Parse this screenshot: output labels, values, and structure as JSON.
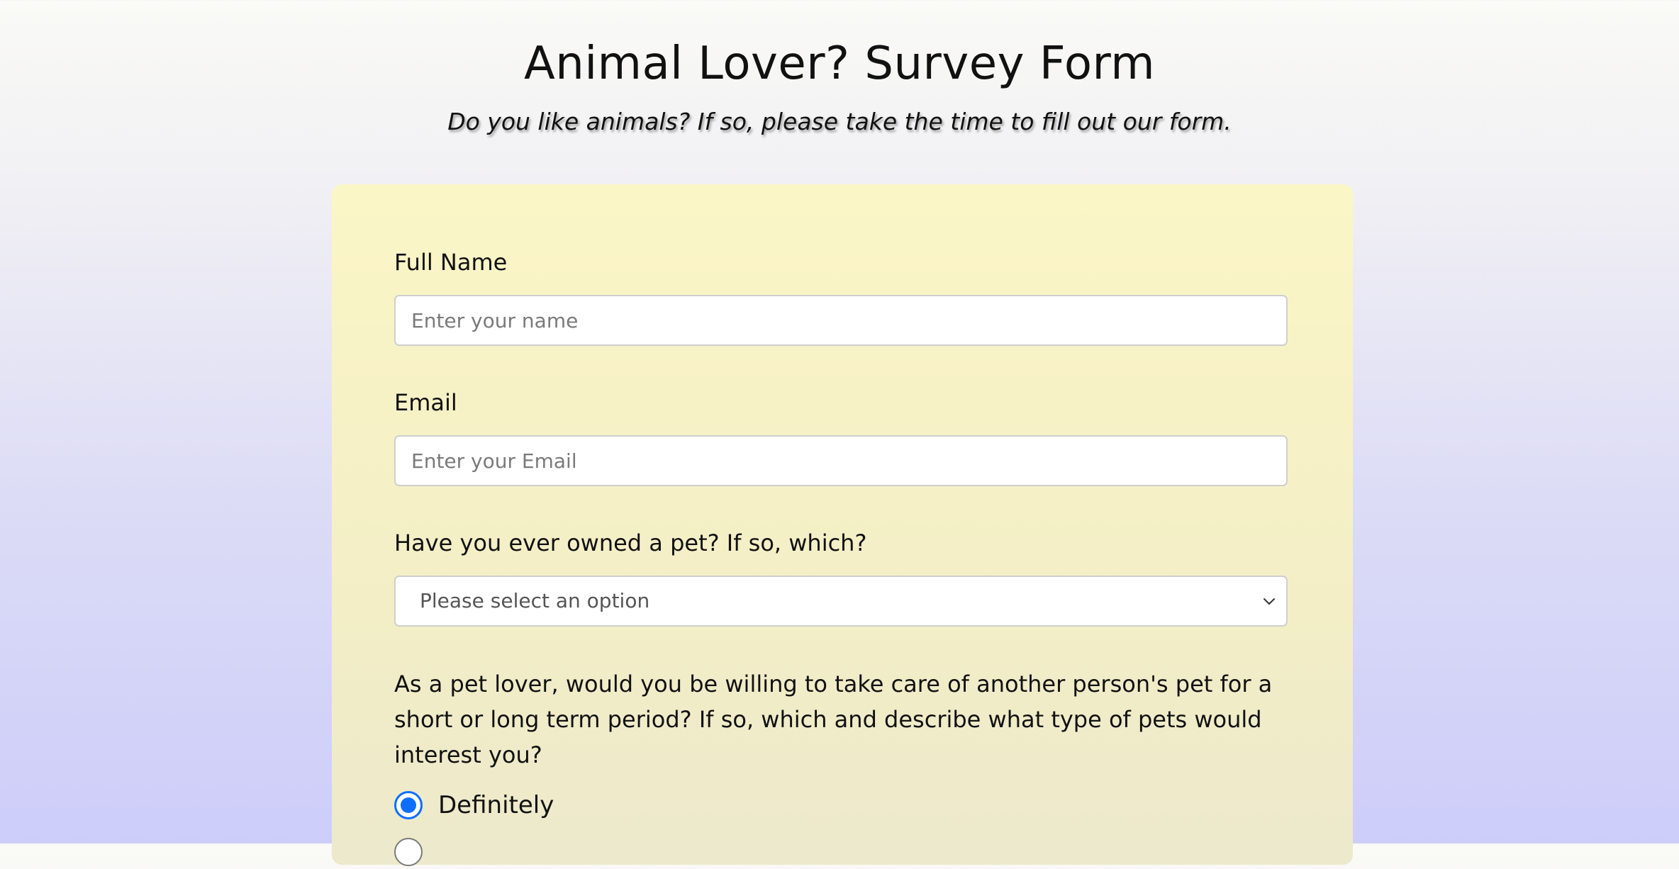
{
  "header": {
    "title": "Animal Lover? Survey Form",
    "subtitle": "Do you like animals? If so, please take the time to fill out our form."
  },
  "form": {
    "name_field": {
      "label": "Full Name",
      "placeholder": "Enter your name",
      "value": ""
    },
    "email_field": {
      "label": "Email",
      "placeholder": "Enter your Email",
      "value": ""
    },
    "pet_select": {
      "label": "Have you ever owned a pet? If so, which?",
      "selected": "Please select an option",
      "icon": "chevron-down-icon"
    },
    "care_question": {
      "text": "As a pet lover, would you be willing to take care of another person's pet for a short or long term period? If so, which and describe what type of pets would interest you?",
      "options": [
        {
          "label": "Definitely",
          "checked": true
        }
      ]
    }
  },
  "colors": {
    "accent": "#0d6efd",
    "card_background": "#f8f4c8",
    "page_gradient_top": "#fafaf6",
    "page_gradient_bottom": "#cdcdfa"
  }
}
